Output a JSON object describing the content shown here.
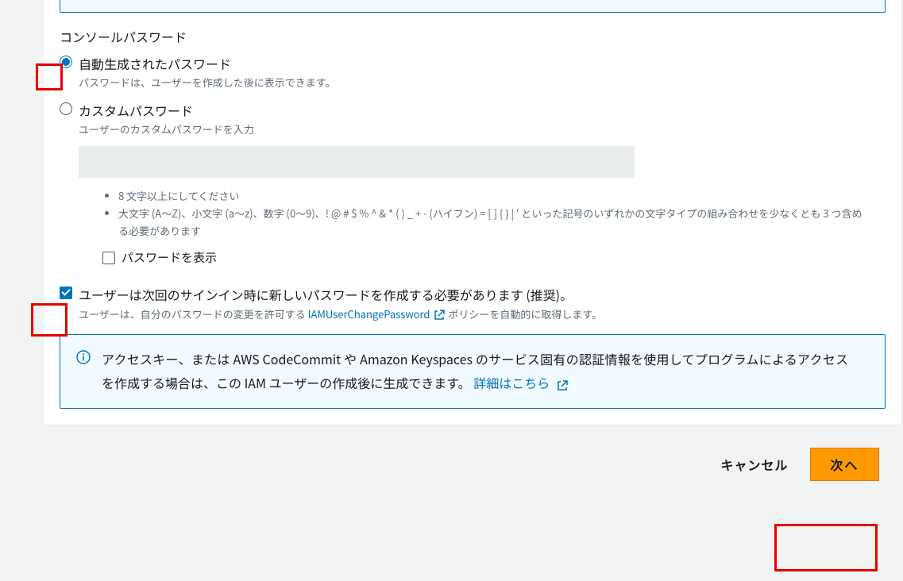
{
  "section_title": "コンソールパスワード",
  "auto_password": {
    "label": "自動生成されたパスワード",
    "desc": "パスワードは、ユーザーを作成した後に表示できます。"
  },
  "custom_password": {
    "label": "カスタムパスワード",
    "desc": "ユーザーのカスタムパスワードを入力",
    "requirements": [
      "8 文字以上にしてください",
      "大文字 (A～Z)、小文字 (a～z)、数字 (0～9)、! @ # $ % ^ & * ( ) _ + - (ハイフン) = [ ] { } | ' といった記号のいずれかの文字タイプの組み合わせを少なくとも 3 つ含める必要があります"
    ],
    "show_password_label": "パスワードを表示"
  },
  "reset_password": {
    "label": "ユーザーは次回のサインイン時に新しいパスワードを作成する必要があります (推奨)。",
    "desc_prefix": "ユーザーは、自分のパスワードの変更を許可する ",
    "desc_link": "IAMUserChangePassword",
    "desc_suffix": " ポリシーを自動的に取得します。"
  },
  "info_box": {
    "text": "アクセスキー、または AWS CodeCommit や Amazon Keyspaces のサービス固有の認証情報を使用してプログラムによるアクセスを作成する場合は、この IAM ユーザーの作成後に生成できます。 ",
    "link": "詳細はこちら"
  },
  "buttons": {
    "cancel": "キャンセル",
    "next": "次へ"
  }
}
